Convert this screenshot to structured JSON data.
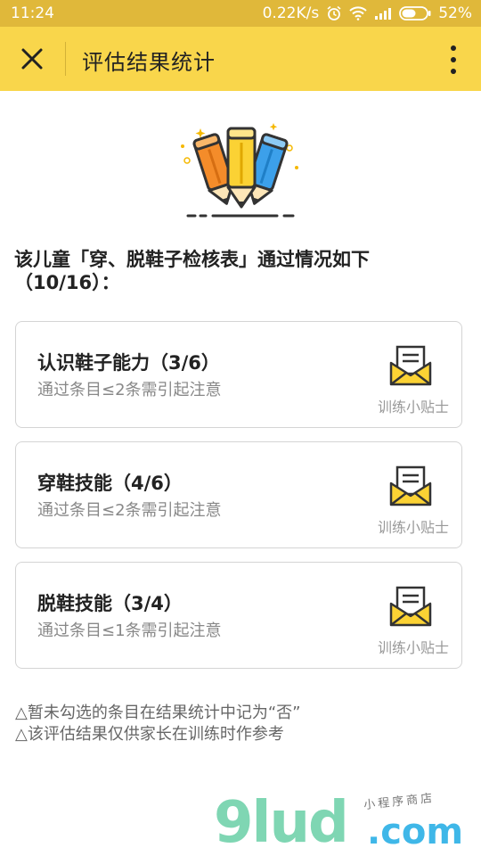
{
  "status_bar": {
    "time": "11:24",
    "speed": "0.22K/s",
    "battery": "52%"
  },
  "nav": {
    "title": "评估结果统计"
  },
  "heading": {
    "text": "该儿童「穿、脱鞋子检核表」通过情况如下（10/16）："
  },
  "cards": [
    {
      "title": "认识鞋子能力（3/6）",
      "note": "通过条目≤2条需引起注意",
      "tips_label": "训练小贴士"
    },
    {
      "title": "穿鞋技能（4/6）",
      "note": "通过条目≤2条需引起注意",
      "tips_label": "训练小贴士"
    },
    {
      "title": "脱鞋技能（3/4）",
      "note": "通过条目≤1条需引起注意",
      "tips_label": "训练小贴士"
    }
  ],
  "notes": [
    "△暂未勾选的条目在结果统计中记为“否”",
    "△该评估结果仅供家长在训练时作参考"
  ],
  "watermark": {
    "brand": "9lud",
    "domain": ".com",
    "tagline": "小程序商店"
  },
  "colors": {
    "accent": "#f9d64b",
    "status_bar": "#e0b83a"
  }
}
